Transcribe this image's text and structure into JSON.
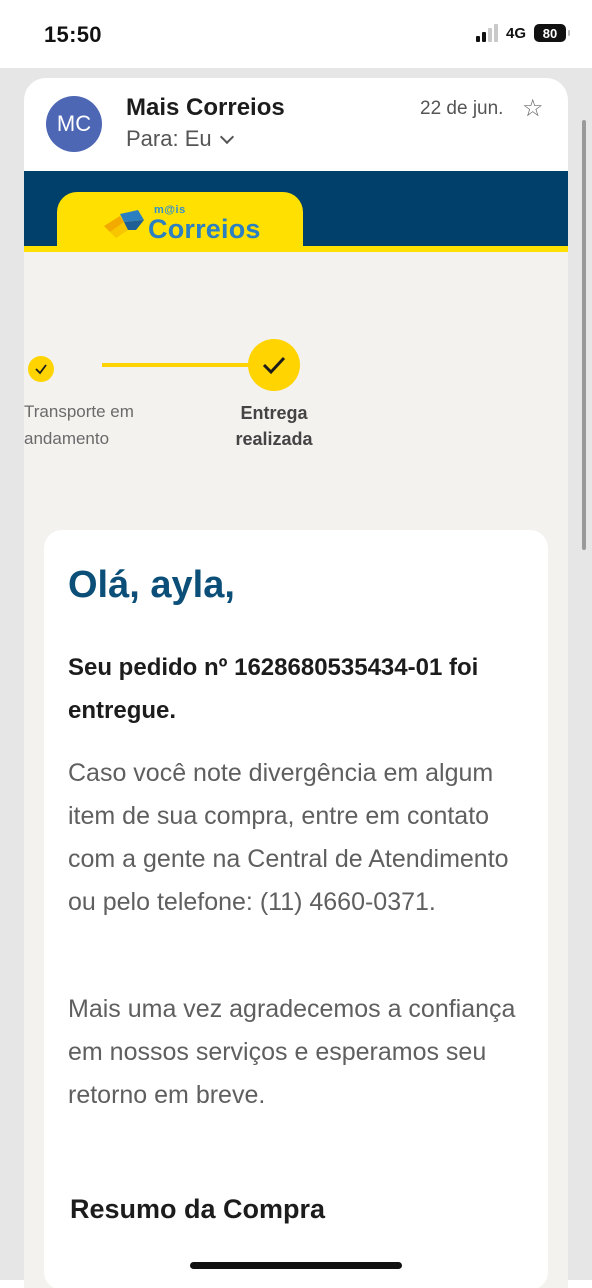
{
  "status_bar": {
    "time": "15:50",
    "network": "4G",
    "battery": "80",
    "signal_icon": "signal-bars-icon"
  },
  "email": {
    "avatar_initials": "MC",
    "sender": "Mais Correios",
    "recipient": "Para: Eu",
    "date": "22 de jun.",
    "star_icon": "star-outline-icon",
    "accent_color": "#4d67b5"
  },
  "banner": {
    "logo_mais": "m@is",
    "logo_text": "Correios",
    "navy": "#00406a",
    "yellow": "#ffe000"
  },
  "tracking": {
    "steps": [
      {
        "label": "Transporte em andamento",
        "state": "done"
      },
      {
        "label": "Entrega realizada",
        "state": "current"
      }
    ]
  },
  "message": {
    "greeting": "Olá, ayla,",
    "order_status": "Seu pedido nº 1628680535434-01 foi entregue.",
    "paragraph_1": "Caso você note divergência em algum item de sua compra, entre em contato com a gente na Central de Atendimento ou pelo telefone: (11) 4660-0371.",
    "paragraph_2": "Mais uma vez agradecemos a confiança em nossos serviços e esperamos seu retorno em breve.",
    "summary_title": "Resumo da Compra"
  }
}
